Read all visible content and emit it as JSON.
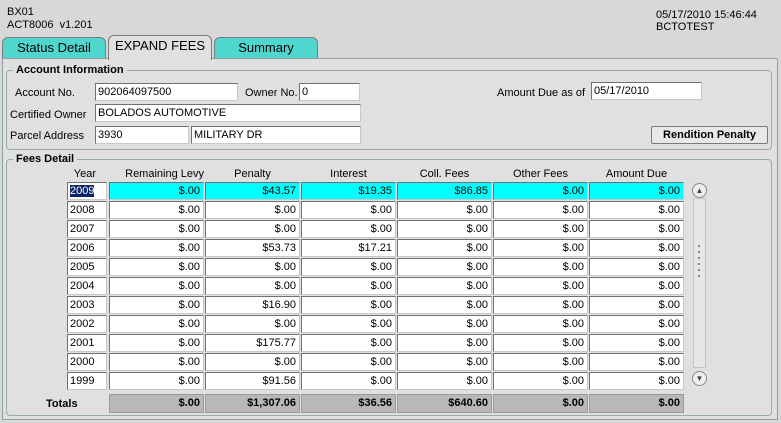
{
  "header": {
    "screen_id": "BX01",
    "program": "ACT8006",
    "version": "v1.201",
    "datetime": "05/17/2010 15:46:44",
    "user": "BCTOTEST"
  },
  "tabs": [
    {
      "label": "Status Detail"
    },
    {
      "label": "EXPAND FEES"
    },
    {
      "label": "Summary"
    }
  ],
  "account": {
    "legend": "Account Information",
    "account_no_label": "Account No.",
    "account_no": "902064097500",
    "owner_no_label": "Owner No.",
    "owner_no": "0",
    "amount_due_label": "Amount Due as of",
    "amount_due_date": "05/17/2010",
    "certified_owner_label": "Certified Owner",
    "certified_owner": "BOLADOS AUTOMOTIVE",
    "parcel_address_label": "Parcel Address",
    "parcel_number": "3930",
    "parcel_street": "MILITARY DR",
    "rendition_button": "Rendition Penalty"
  },
  "fees": {
    "legend": "Fees Detail",
    "columns": [
      "Year",
      "Remaining Levy",
      "Penalty",
      "Interest",
      "Coll. Fees",
      "Other Fees",
      "Amount Due"
    ],
    "rows": [
      {
        "year": "2009",
        "levy": "$.00",
        "penalty": "$43.57",
        "interest": "$19.35",
        "coll": "$86.85",
        "other": "$.00",
        "due": "$.00"
      },
      {
        "year": "2008",
        "levy": "$.00",
        "penalty": "$.00",
        "interest": "$.00",
        "coll": "$.00",
        "other": "$.00",
        "due": "$.00"
      },
      {
        "year": "2007",
        "levy": "$.00",
        "penalty": "$.00",
        "interest": "$.00",
        "coll": "$.00",
        "other": "$.00",
        "due": "$.00"
      },
      {
        "year": "2006",
        "levy": "$.00",
        "penalty": "$53.73",
        "interest": "$17.21",
        "coll": "$.00",
        "other": "$.00",
        "due": "$.00"
      },
      {
        "year": "2005",
        "levy": "$.00",
        "penalty": "$.00",
        "interest": "$.00",
        "coll": "$.00",
        "other": "$.00",
        "due": "$.00"
      },
      {
        "year": "2004",
        "levy": "$.00",
        "penalty": "$.00",
        "interest": "$.00",
        "coll": "$.00",
        "other": "$.00",
        "due": "$.00"
      },
      {
        "year": "2003",
        "levy": "$.00",
        "penalty": "$16.90",
        "interest": "$.00",
        "coll": "$.00",
        "other": "$.00",
        "due": "$.00"
      },
      {
        "year": "2002",
        "levy": "$.00",
        "penalty": "$.00",
        "interest": "$.00",
        "coll": "$.00",
        "other": "$.00",
        "due": "$.00"
      },
      {
        "year": "2001",
        "levy": "$.00",
        "penalty": "$175.77",
        "interest": "$.00",
        "coll": "$.00",
        "other": "$.00",
        "due": "$.00"
      },
      {
        "year": "2000",
        "levy": "$.00",
        "penalty": "$.00",
        "interest": "$.00",
        "coll": "$.00",
        "other": "$.00",
        "due": "$.00"
      },
      {
        "year": "1999",
        "levy": "$.00",
        "penalty": "$91.56",
        "interest": "$.00",
        "coll": "$.00",
        "other": "$.00",
        "due": "$.00"
      }
    ],
    "totals": {
      "label": "Totals",
      "levy": "$.00",
      "penalty": "$1,307.06",
      "interest": "$36.56",
      "coll": "$640.60",
      "other": "$.00",
      "due": "$.00"
    }
  },
  "colors": {
    "highlight": "#00ffff",
    "tab_accent": "#4fd6cf",
    "selection": "#0a246a"
  },
  "icons": {
    "scroll_up": "scroll-up-icon",
    "scroll_down": "scroll-down-icon"
  }
}
